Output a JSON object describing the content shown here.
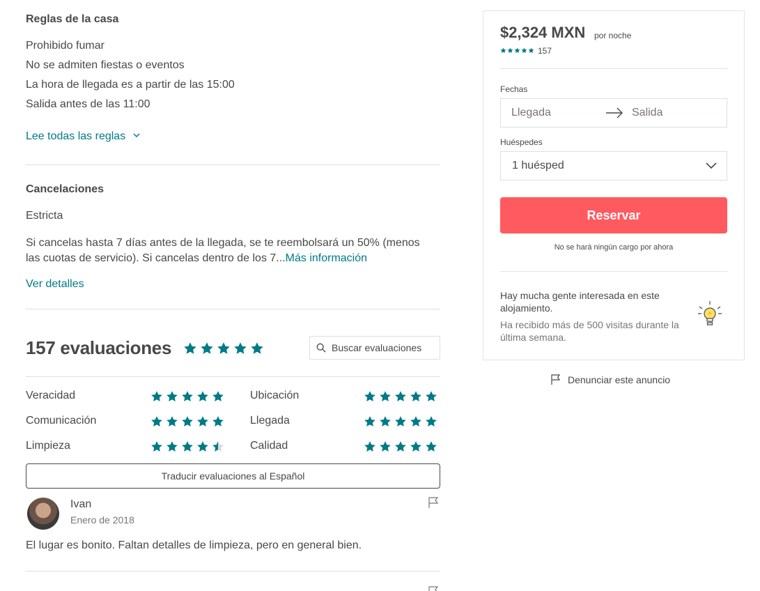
{
  "house_rules": {
    "title": "Reglas de la casa",
    "rules": [
      "Prohibido fumar",
      "No se admiten fiestas o eventos",
      "La hora de llegada es a partir de las 15:00",
      "Salida antes de las 11:00"
    ],
    "read_all_link": "Lee todas las reglas"
  },
  "cancellations": {
    "title": "Cancelaciones",
    "policy": "Estricta",
    "description_line1": "Si cancelas hasta 7 días antes de la llegada, se te reembolsará un 50% (menos",
    "description_line2": "las cuotas de servicio). Si cancelas dentro de los 7...",
    "more_info_link": "Más información",
    "details_link": "Ver detalles"
  },
  "reviews": {
    "title": "157 evaluaciones",
    "overall_rating": 5,
    "search_placeholder": "Buscar evaluaciones",
    "categories": [
      {
        "label": "Veracidad",
        "rating": 5
      },
      {
        "label": "Ubicación",
        "rating": 5
      },
      {
        "label": "Comunicación",
        "rating": 5
      },
      {
        "label": "Llegada",
        "rating": 5
      },
      {
        "label": "Limpieza",
        "rating": 4.5
      },
      {
        "label": "Calidad",
        "rating": 5
      }
    ],
    "translate_button": "Traducir evaluaciones al Español",
    "items": [
      {
        "name": "Ivan",
        "date": "Enero de 2018",
        "text": "El lugar es bonito. Faltan detalles de limpieza, pero en general bien."
      }
    ]
  },
  "booking": {
    "price": "$2,324 MXN",
    "per_night": "por noche",
    "rating": 5,
    "review_count": "157",
    "dates_label": "Fechas",
    "checkin_placeholder": "Llegada",
    "checkout_placeholder": "Salida",
    "guests_label": "Huéspedes",
    "guests_value": "1 huésped",
    "reserve_button": "Reservar",
    "no_charge_note": "No se hará ningún cargo por ahora",
    "interest_title": "Hay mucha gente interesada en este alojamiento.",
    "interest_sub": "Ha recibido más de 500 visitas durante la última semana."
  },
  "report_link": "Denunciar este anuncio",
  "colors": {
    "teal": "#007a87",
    "rausch": "#ff5a5f",
    "text": "#484848",
    "muted": "#767676",
    "divider": "#dce0e0"
  },
  "icons": {
    "star": "star-icon",
    "search": "search-icon",
    "flag": "flag-icon",
    "chevron": "chevron-down-icon",
    "arrow": "arrow-right-icon",
    "bulb": "lightbulb-icon"
  }
}
